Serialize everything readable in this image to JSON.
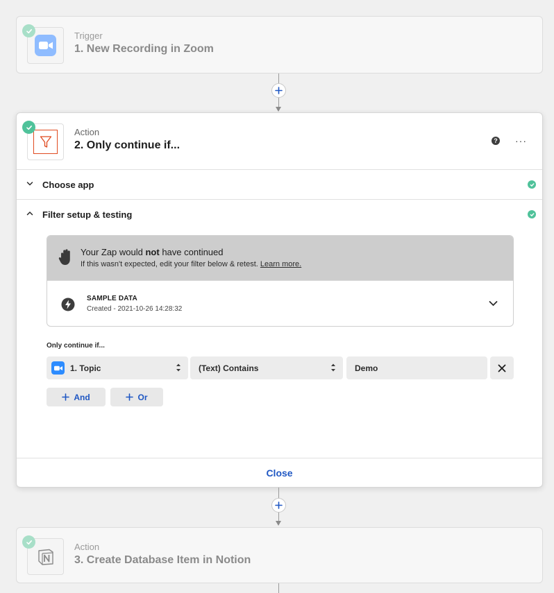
{
  "steps": {
    "trigger": {
      "type": "Trigger",
      "title": "1. New Recording in Zoom",
      "icon": "zoom-camera-icon"
    },
    "filter": {
      "type": "Action",
      "title": "2. Only continue if...",
      "icon": "filter-funnel-icon"
    },
    "notion": {
      "type": "Action",
      "title": "3. Create Database Item in Notion",
      "icon": "notion-logo-icon"
    }
  },
  "header_actions": {
    "help": "?",
    "more": "···"
  },
  "sections": {
    "choose_app": "Choose app",
    "filter_setup": "Filter setup & testing"
  },
  "result": {
    "title_pre": "Your Zap would ",
    "title_bold": "not",
    "title_post": " have continued",
    "sub_text": "If this wasn't expected, edit your filter below & retest. ",
    "learn_more": "Learn more.",
    "sample_title": "SAMPLE DATA",
    "sample_date": "Created - 2021-10-26 14:28:32"
  },
  "filter": {
    "label": "Only continue if...",
    "field": "1. Topic",
    "operator": "(Text) Contains",
    "value": "Demo",
    "and_label": "And",
    "or_label": "Or"
  },
  "close_label": "Close",
  "colors": {
    "accent": "#1f57c3",
    "success": "#4fc29a",
    "zoom_blue": "#2d8cff",
    "filter_orange": "#e04a1f"
  }
}
